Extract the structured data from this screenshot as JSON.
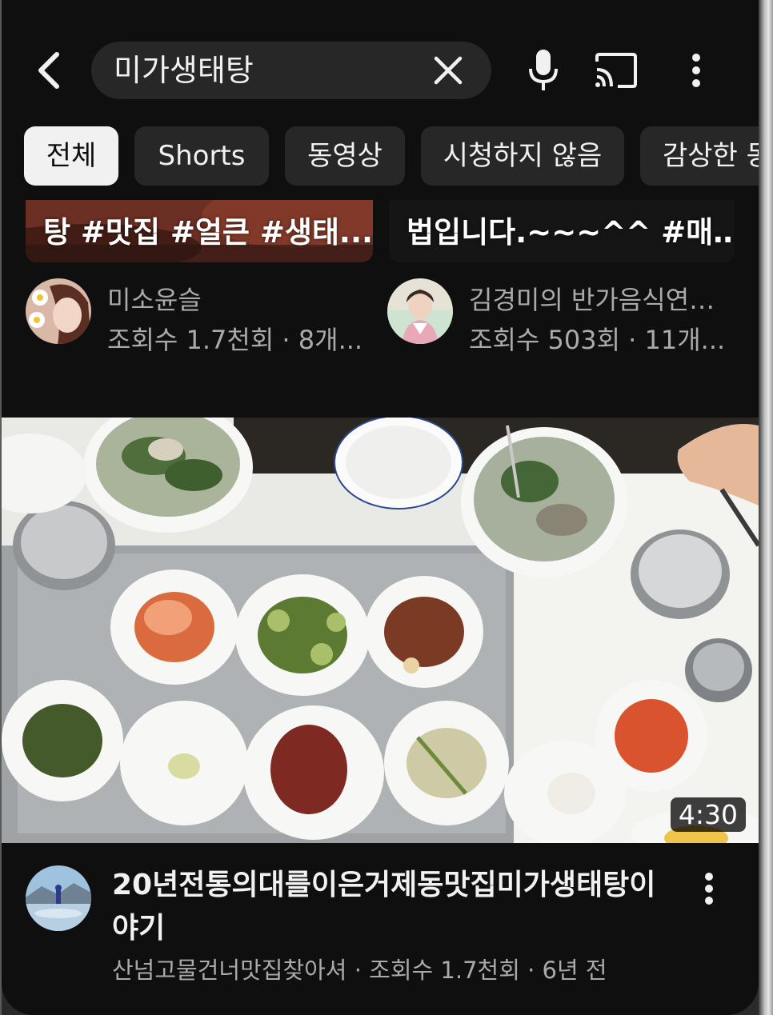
{
  "header": {
    "search_query": "미가생태탕",
    "icons": [
      "back-arrow-icon",
      "clear-x-icon",
      "microphone-icon",
      "cast-icon",
      "more-vert-icon"
    ]
  },
  "chips": [
    {
      "label": "전체",
      "active": true
    },
    {
      "label": "Shorts",
      "active": false
    },
    {
      "label": "동영상",
      "active": false
    },
    {
      "label": "시청하지 않음",
      "active": false
    },
    {
      "label": "감상한 동",
      "active": false
    }
  ],
  "shorts": [
    {
      "caption": "탕 #맛집 #얼큰 #생태...",
      "channel": "미소윤슬",
      "meta": "조회수 1.7천회 · 8개...",
      "avatar": "avatar-woman-with-flowers"
    },
    {
      "caption": "법입니다.~~~^^ #매…",
      "channel": "김경미의 반가음식연…",
      "meta": "조회수 503회 · 11개...",
      "avatar": "avatar-woman-hanbok"
    }
  ],
  "video": {
    "title": "20년전통의대를이은거제동맛집미가생태탕이야기",
    "channel": "산넘고물건너맛집찾아셔",
    "views": "조회수 1.7천회",
    "age": "6년 전",
    "separator": " · ",
    "duration": "4:30",
    "thumbnail_desc_icon": "food-thumbnail-image"
  },
  "colors": {
    "background": "#0f0f0f",
    "chip": "#272727",
    "chip_active": "#f1f1f1",
    "text_primary": "#f1f1f1",
    "text_secondary": "#aaaaaa"
  }
}
